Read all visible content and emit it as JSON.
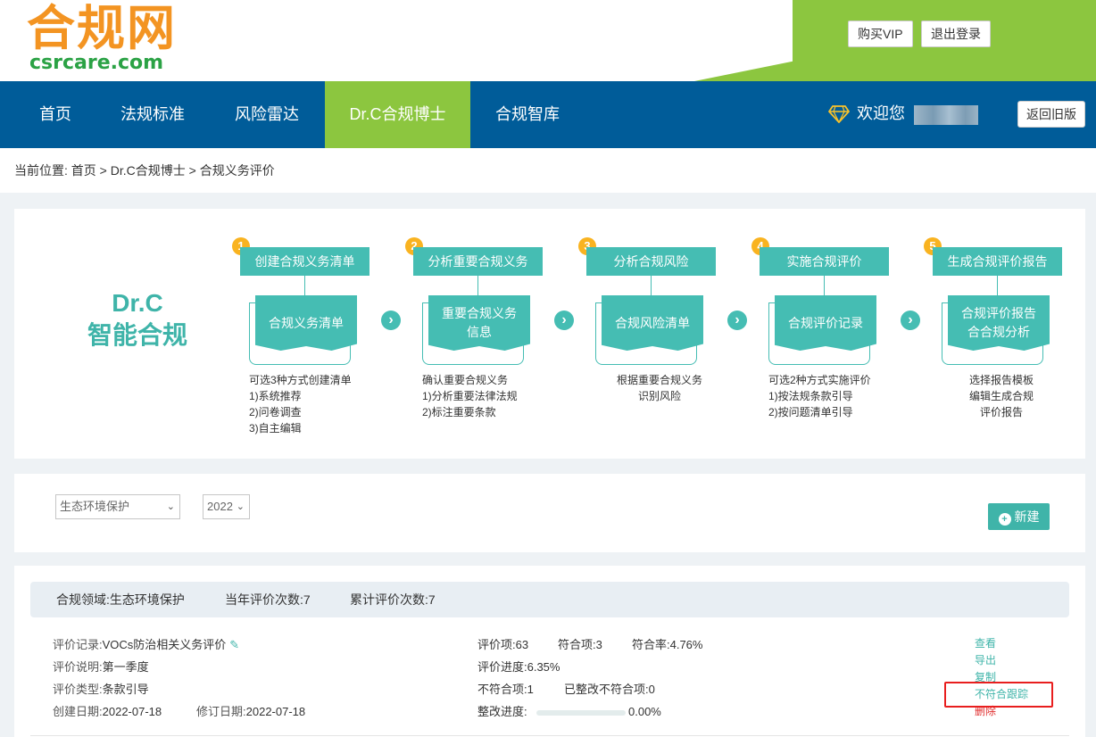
{
  "logo": {
    "cn": "合规网",
    "en": "csrcare.com"
  },
  "header": {
    "vip_button": "购买VIP",
    "logout_button": "退出登录"
  },
  "nav": {
    "items": [
      "首页",
      "法规标准",
      "风险雷达",
      "Dr.C合规博士",
      "合规智库"
    ],
    "active_index": 3,
    "welcome": "欢迎您",
    "old_version_button": "返回旧版"
  },
  "breadcrumb": {
    "prefix": "当前位置:",
    "path": [
      "首页",
      "Dr.C合规博士",
      "合规义务评价"
    ],
    "separator": ">"
  },
  "brand": {
    "line1": "Dr.C",
    "line2": "智能合规"
  },
  "steps": [
    {
      "num": "1",
      "title": "创建合规义务清单",
      "doc": "合规义务清单",
      "desc": [
        "可选3种方式创建清单",
        "1)系统推荐",
        "2)问卷调查",
        "3)自主编辑"
      ]
    },
    {
      "num": "2",
      "title": "分析重要合规义务",
      "doc": "重要合规义务信息",
      "desc": [
        "确认重要合规义务",
        "1)分析重要法律法规",
        "2)标注重要条款"
      ]
    },
    {
      "num": "3",
      "title": "分析合规风险",
      "doc": "合规风险清单",
      "desc": [
        "根据重要合规义务",
        "识别风险"
      ]
    },
    {
      "num": "4",
      "title": "实施合规评价",
      "doc": "合规评价记录",
      "desc": [
        "可选2种方式实施评价",
        "1)按法规条款引导",
        "2)按问题清单引导"
      ]
    },
    {
      "num": "5",
      "title": "生成合规评价报告",
      "doc": "合规评价报告合合规分析",
      "desc": [
        "选择报告模板",
        "编辑生成合规",
        "评价报告"
      ]
    }
  ],
  "filter": {
    "domain_select": "生态环境保护",
    "year_select": "2022",
    "new_button": "新建"
  },
  "summary": {
    "domain": "合规领域:生态环境保护",
    "year_count": "当年评价次数:7",
    "total_count": "累计评价次数:7"
  },
  "record": {
    "name_label": "评价记录:",
    "name": "VOCs防治相关义务评价",
    "desc_label": "评价说明:",
    "desc": "第一季度",
    "type_label": "评价类型:",
    "type": "条款引导",
    "created_label": "创建日期:",
    "created": "2022-07-18",
    "modified_label": "修订日期:",
    "modified": "2022-07-18",
    "items": "评价项:63",
    "compliant": "符合项:3",
    "rate": "符合率:4.76%",
    "progress_text": "评价进度:6.35%",
    "noncompliant": "不符合项:1",
    "fixed": "已整改不符合项:0",
    "fix_label": "整改进度:",
    "fix_value": "0.00%",
    "fix_fraction": 0
  },
  "actions": [
    "查看",
    "导出",
    "复制",
    "不符合跟踪",
    "删除"
  ],
  "colors": {
    "nav_blue": "#005c99",
    "accent_green": "#8cc63f",
    "teal": "#45bdb3",
    "orange": "#f39422",
    "danger": "#e03131"
  }
}
